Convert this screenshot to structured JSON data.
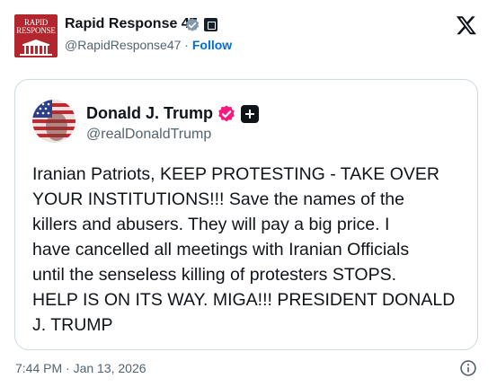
{
  "author": {
    "avatar_text": [
      "RAPID",
      "RESPONSE"
    ],
    "name": "Rapid Response 47",
    "handle": "@RapidResponse47",
    "separator": "·",
    "follow_label": "Follow"
  },
  "icons": {
    "verified": "gray-verified-badge-icon",
    "affiliate": "affiliate-badge-icon",
    "logo": "x-logo-icon",
    "quoted_verified": "pink-verified-badge-icon",
    "quoted_affiliate": "plus-badge-icon",
    "info": "info-icon"
  },
  "quoted": {
    "name": "Donald J. Trump",
    "handle": "@realDonaldTrump",
    "lines": [
      "Iranian Patriots, KEEP PROTESTING - TAKE OVER",
      "YOUR INSTITUTIONS!!! Save the names of the",
      "killers and abusers. They will pay a big price. I",
      "have cancelled all meetings with Iranian Officials",
      "until the senseless killing of protesters STOPS.",
      "HELP IS ON ITS WAY. MIGA!!! PRESIDENT DONALD",
      "J. TRUMP"
    ]
  },
  "timestamp": "7:44 PM · Jan 13, 2026",
  "colors": {
    "text": "#0f1419",
    "secondary": "#536471",
    "link": "#006fd6",
    "border": "#cfd9de",
    "brand_red": "#b3262d",
    "verified_pink": "#f91880",
    "verified_gray": "#829aab"
  }
}
